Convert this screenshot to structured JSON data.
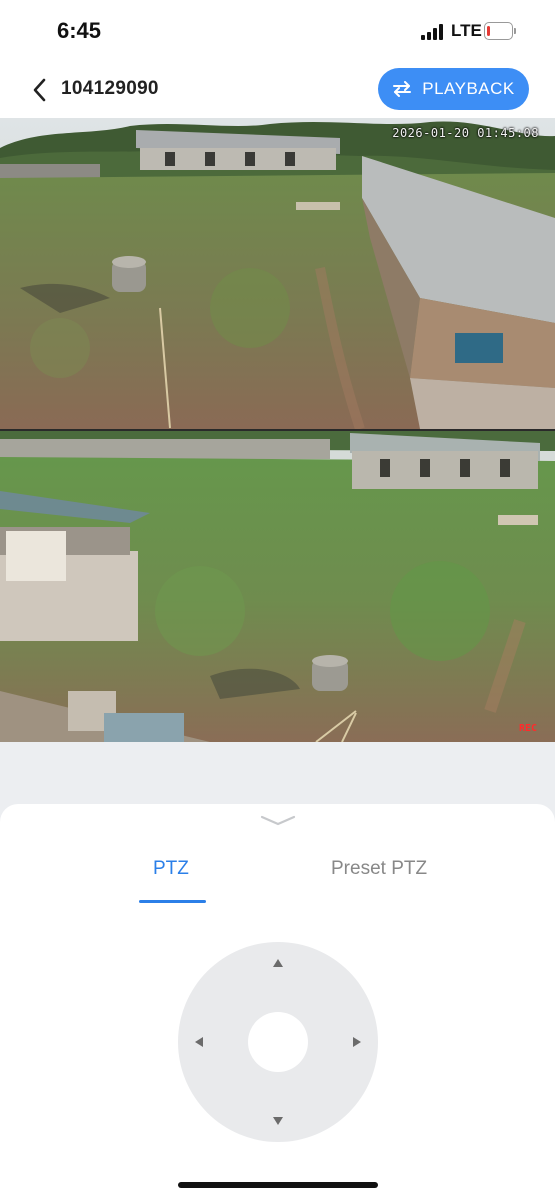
{
  "status_bar": {
    "time": "6:45",
    "network": "LTE",
    "battery_level": 0.1,
    "battery_color": "#e53935"
  },
  "nav": {
    "title": "104129090",
    "playback_label": "PLAYBACK",
    "playback_color": "#3d8ef5"
  },
  "feeds": [
    {
      "timestamp": "2026-01-20 01:45:08",
      "rec": ""
    },
    {
      "timestamp": "",
      "rec": "REC"
    }
  ],
  "ptz_panel": {
    "tabs": [
      {
        "label": "PTZ",
        "active": true
      },
      {
        "label": "Preset PTZ",
        "active": false
      }
    ],
    "accent_color": "#2b7fe8",
    "icons": [
      "chevron-down-icon",
      "arrow-up-icon",
      "arrow-down-icon",
      "arrow-left-icon",
      "arrow-right-icon"
    ]
  }
}
